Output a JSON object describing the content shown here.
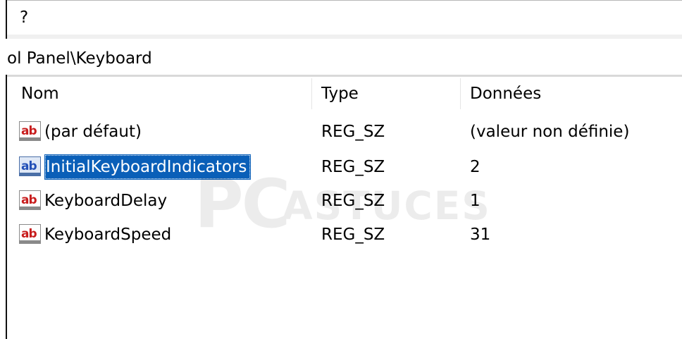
{
  "menu_bar": {
    "help_label": "?"
  },
  "address_bar": {
    "path": "ol Panel\\Keyboard"
  },
  "list_view": {
    "headers": [
      "Nom",
      "Type",
      "Données"
    ],
    "rows": [
      {
        "name": "(par défaut)",
        "type": "REG_SZ",
        "data": "(valeur non définie)",
        "icon": "registry-string-icon"
      },
      {
        "name": "InitialKeyboardIndicators",
        "type": "REG_SZ",
        "data": "2",
        "icon": "registry-string-icon"
      },
      {
        "name": "KeyboardDelay",
        "type": "REG_SZ",
        "data": "1",
        "icon": "registry-string-icon"
      },
      {
        "name": "KeyboardSpeed",
        "type": "REG_SZ",
        "data": "31",
        "icon": "registry-string-icon"
      }
    ],
    "icon_label": "ab"
  },
  "watermark": {
    "pc": "PC",
    "actuces": "ASTUCES"
  },
  "colors": {
    "selection": "#0a5fb8",
    "icon_red": "#c81d1d",
    "icon_blue": "#2350b7"
  }
}
